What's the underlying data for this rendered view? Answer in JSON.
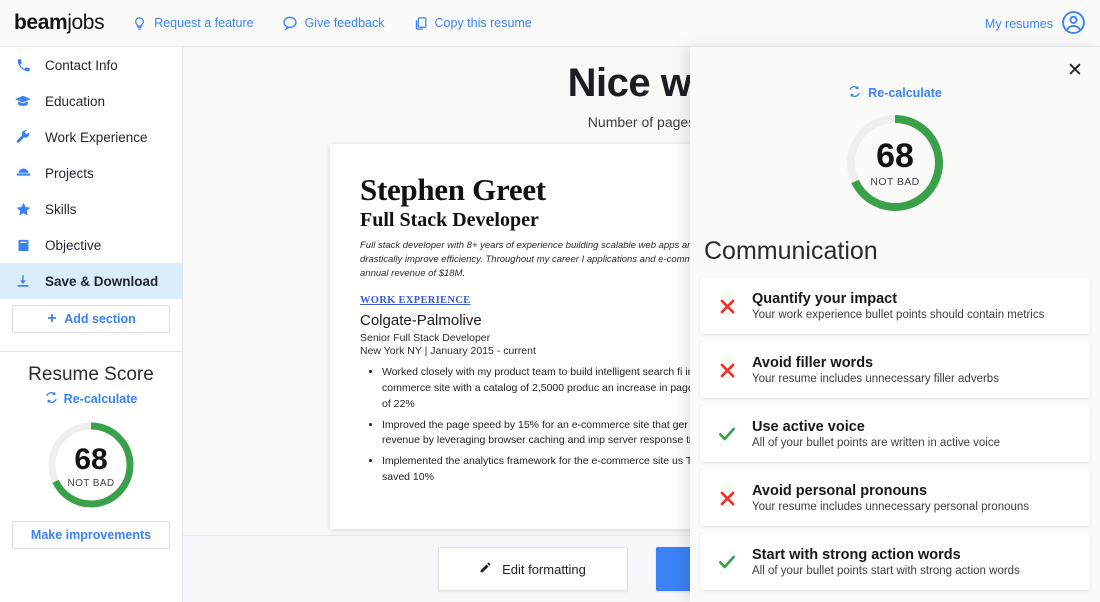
{
  "header": {
    "brand_bold": "beam",
    "brand_light": "jobs",
    "nav": [
      {
        "label": "Request a feature",
        "icon": "lightbulb-icon"
      },
      {
        "label": "Give feedback",
        "icon": "chat-bubble-icon"
      },
      {
        "label": "Copy this resume",
        "icon": "copy-icon"
      }
    ],
    "account_label": "My resumes",
    "account_icon": "user-circle-icon"
  },
  "sidebar": {
    "items": [
      {
        "label": "Contact Info",
        "icon": "phone-icon",
        "active": false
      },
      {
        "label": "Education",
        "icon": "graduation-cap-icon",
        "active": false
      },
      {
        "label": "Work Experience",
        "icon": "wrench-icon",
        "active": false
      },
      {
        "label": "Projects",
        "icon": "hard-hat-icon",
        "active": false
      },
      {
        "label": "Skills",
        "icon": "star-icon",
        "active": false
      },
      {
        "label": "Objective",
        "icon": "book-icon",
        "active": false
      },
      {
        "label": "Save & Download",
        "icon": "download-icon",
        "active": true
      }
    ],
    "add_section_label": "Add section",
    "score": {
      "title": "Resume Score",
      "recalculate_label": "Re-calculate",
      "value": "68",
      "rating": "NOT BAD",
      "percent": 68,
      "improve_label": "Make improvements",
      "ring_color": "#3aa14b",
      "track_color": "#efefed"
    }
  },
  "main": {
    "title": "Nice wo",
    "subtitle": "Number of pages",
    "resume": {
      "name": "Stephen Greet",
      "role": "Full Stack Developer",
      "summary": "Full stack developer with 8+ years of experience building scalable web apps and internal tools that drastically improve efficiency. Throughout my career I applications and e-commerce sites with a total annual revenue of $18M.",
      "section_label": "WORK EXPERIENCE",
      "company": "Colgate-Palmolive",
      "job_title": "Senior Full Stack Developer",
      "meta": "New York NY  |  January 2015 - current",
      "bullets": [
        "Worked closely with my product team to build intelligent search fi in Angular for an e-commerce site with a catalog of 2,5000 produc an increase in page views per session of 22%",
        "Improved the page speed by 15% for an e-commerce site that ger $25M annually in revenue by leveraging browser caching and imp server response times",
        "Implemented the analytics framework for the e-commerce site us Tag Manager which saved 10%"
      ]
    },
    "footer": {
      "edit_label": "Edit formatting",
      "edit_icon": "pencil-icon",
      "primary_label": ""
    }
  },
  "panel": {
    "close_icon": "close-icon",
    "recalculate_label": "Re-calculate",
    "recalculate_icon": "refresh-icon",
    "score_value": "68",
    "score_rating": "NOT BAD",
    "score_percent": 68,
    "heading": "Communication",
    "tips": [
      {
        "status": "fail",
        "icon": "x-icon",
        "title": "Quantify your impact",
        "description": "Your work experience bullet points should contain metrics"
      },
      {
        "status": "fail",
        "icon": "x-icon",
        "title": "Avoid filler words",
        "description": "Your resume includes unnecessary filler adverbs"
      },
      {
        "status": "pass",
        "icon": "check-icon",
        "title": "Use active voice",
        "description": "All of your bullet points are written in active voice"
      },
      {
        "status": "fail",
        "icon": "x-icon",
        "title": "Avoid personal pronouns",
        "description": "Your resume includes unnecessary personal pronouns"
      },
      {
        "status": "pass",
        "icon": "check-icon",
        "title": "Start with strong action words",
        "description": "All of your bullet points start with strong action words"
      }
    ]
  },
  "colors": {
    "accent_blue": "#3b82f6",
    "success_green": "#3aa14b",
    "fail_red": "#e8342a",
    "sidebar_active": "#d9edfb"
  }
}
